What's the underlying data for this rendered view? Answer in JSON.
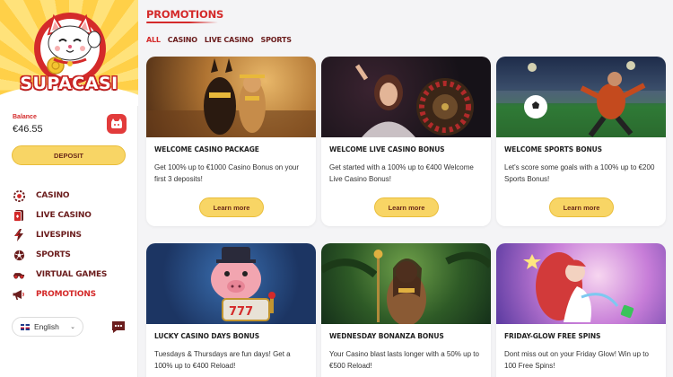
{
  "brand": {
    "logo_text": "SUPACASI"
  },
  "account": {
    "balance_label": "Balance",
    "balance_value": "€46.55"
  },
  "actions": {
    "deposit_label": "DEPOSIT",
    "learn_more_label": "Learn more"
  },
  "nav": {
    "items": [
      {
        "label": "CASINO",
        "icon": "casino-chip-icon"
      },
      {
        "label": "LIVE CASINO",
        "icon": "live-cards-icon"
      },
      {
        "label": "LIVESPINS",
        "icon": "lightning-icon"
      },
      {
        "label": "SPORTS",
        "icon": "soccer-ball-icon"
      },
      {
        "label": "VIRTUAL GAMES",
        "icon": "race-car-icon"
      },
      {
        "label": "PROMOTIONS",
        "icon": "megaphone-icon",
        "active": true
      }
    ]
  },
  "language": {
    "label": "English"
  },
  "main": {
    "title": "PROMOTIONS",
    "filters": [
      "ALL",
      "CASINO",
      "LIVE CASINO",
      "SPORTS"
    ],
    "active_filter": "ALL"
  },
  "promotions": [
    {
      "title": "WELCOME CASINO PACKAGE",
      "description": "Get 100% up to €1000 Casino Bonus on your first 3 deposits!"
    },
    {
      "title": "WELCOME LIVE CASINO BONUS",
      "description": "Get started with a 100% up to €400 Welcome Live Casino Bonus!"
    },
    {
      "title": "WELCOME SPORTS BONUS",
      "description": "Let's score some goals with a 100% up to €200 Sports Bonus!"
    },
    {
      "title": "LUCKY CASINO DAYS BONUS",
      "description": "Tuesdays & Thursdays are fun days! Get a 100% up to €400 Reload!"
    },
    {
      "title": "WEDNESDAY BONANZA BONUS",
      "description": "Your Casino blast lasts longer with a 50% up to €500 Reload!"
    },
    {
      "title": "FRIDAY-GLOW FREE SPINS",
      "description": "Dont miss out on your Friday Glow! Win up to 100 Free Spins!"
    }
  ],
  "colors": {
    "brand_red": "#d42a2a",
    "accent_yellow": "#f8d565",
    "nav_text": "#6b1d1d"
  }
}
